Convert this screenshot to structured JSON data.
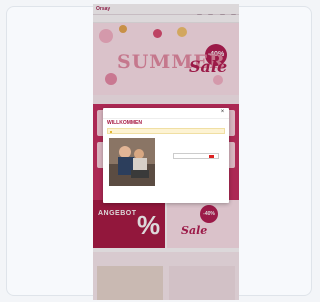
{
  "site": {
    "logo": "Orsay"
  },
  "hero": {
    "title": "SUMMER",
    "sale": "Sale",
    "badge": "-40%"
  },
  "promo": {
    "title": "ANGEBOT",
    "badge": "-40%",
    "sale": "Sale",
    "pct": "%"
  },
  "modal": {
    "title": "WILLKOMMEN"
  },
  "colors": {
    "accent": "#a5143f",
    "hero_bg": "#fde4ec"
  }
}
